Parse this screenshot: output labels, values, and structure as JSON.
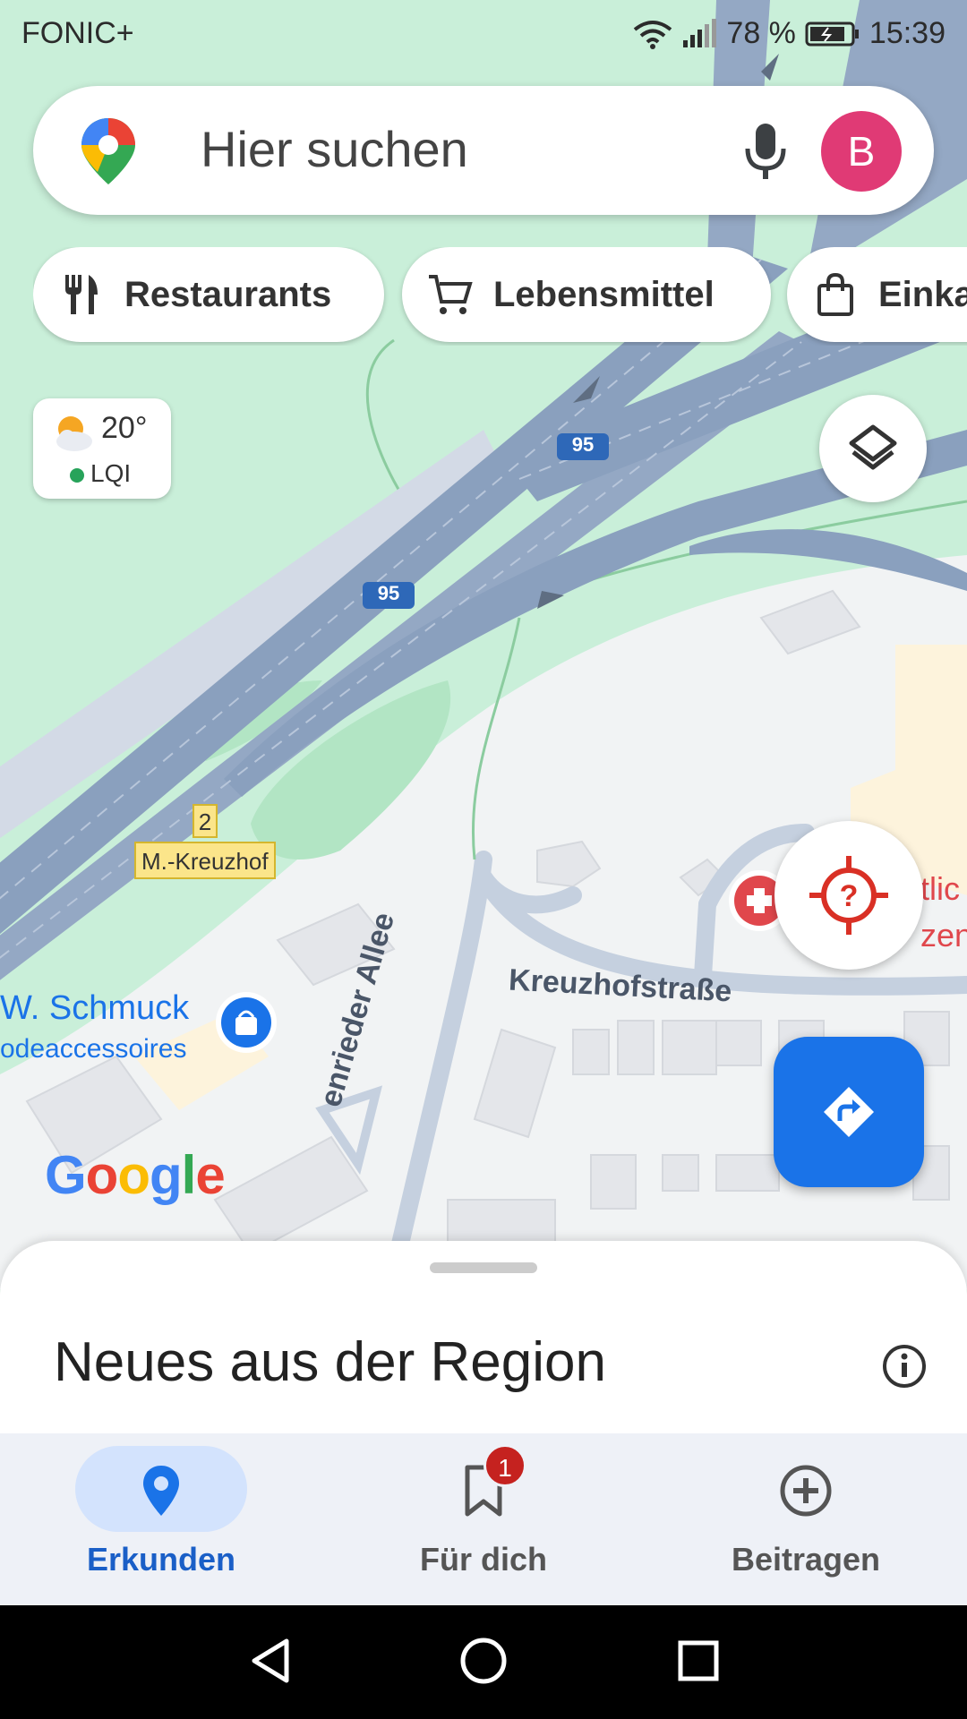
{
  "status_bar": {
    "carrier": "FONIC+",
    "battery": "78 %",
    "time": "15:39",
    "icons": [
      "wifi-icon",
      "signal-icon",
      "battery-icon"
    ]
  },
  "search": {
    "placeholder": "Hier suchen",
    "avatar_letter": "B",
    "icons": [
      "maps-pin-logo",
      "microphone-icon"
    ]
  },
  "chips": [
    {
      "label": "Restaurants",
      "icon": "fork-knife-icon"
    },
    {
      "label": "Lebensmittel",
      "icon": "cart-icon"
    },
    {
      "label": "Einka",
      "icon": "shopping-bag-icon"
    }
  ],
  "weather": {
    "temperature": "20°",
    "aqi_label": "LQI",
    "icon": "partly-cloudy-icon"
  },
  "map": {
    "road_shields": [
      "95",
      "95"
    ],
    "tram_stop_number": "2",
    "tram_stop_name": "M.-Kreuzhof",
    "street_1": "Kreuzhofstraße",
    "street_2": "enrieder Allee",
    "poi_name_line1": "W. Schmuck",
    "poi_name_line2": "odeaccessoires",
    "poi_right_line1": "tlic",
    "poi_right_line2": "zen",
    "google_logo": "Google",
    "colors": {
      "park": "#c9efd9",
      "highway": "#8aa0be",
      "urban": "#f1f3f4",
      "poi_blue": "#1a73e8"
    }
  },
  "sheet": {
    "title": "Neues aus der Region"
  },
  "bottom_nav": [
    {
      "label": "Erkunden",
      "icon": "explore-pin-icon",
      "active": true
    },
    {
      "label": "Für dich",
      "icon": "bookmark-icon",
      "badge": "1"
    },
    {
      "label": "Beitragen",
      "icon": "add-circle-icon"
    }
  ],
  "system_nav": [
    "back-icon",
    "home-icon",
    "recents-icon"
  ]
}
